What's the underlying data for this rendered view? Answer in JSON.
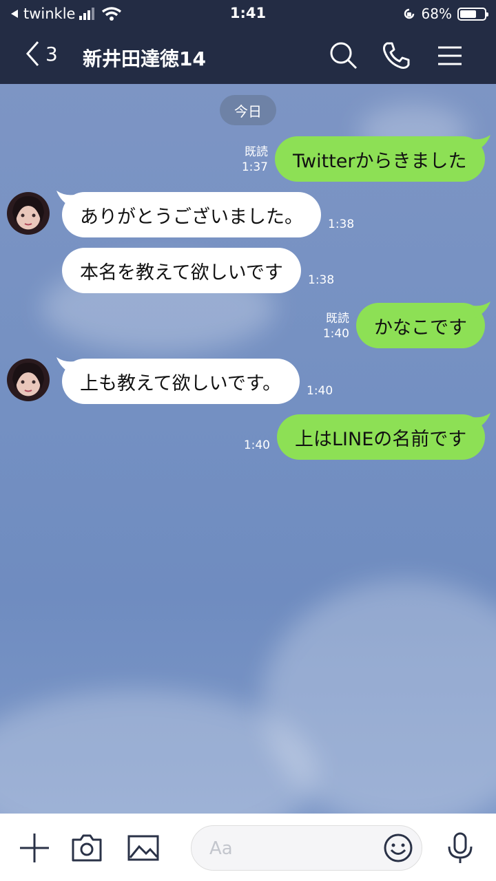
{
  "status_bar": {
    "carrier": "twinkle",
    "time": "1:41",
    "battery_pct": "68%",
    "battery_level": 0.68
  },
  "header": {
    "back_count": "3",
    "title": "新井田達徳14"
  },
  "date_divider": "今日",
  "messages": [
    {
      "dir": "out",
      "text": "Twitterからきました",
      "time": "1:37",
      "read": "既読"
    },
    {
      "dir": "in",
      "text": "ありがとうございました。",
      "time": "1:38",
      "avatar": true
    },
    {
      "dir": "in",
      "text": "本名を教えて欲しいです",
      "time": "1:38",
      "avatar": false
    },
    {
      "dir": "out",
      "text": "かなこです",
      "time": "1:40",
      "read": "既読"
    },
    {
      "dir": "in",
      "text": "上も教えて欲しいです。",
      "time": "1:40",
      "avatar": true
    },
    {
      "dir": "out",
      "text": "上はLINEの名前です",
      "time": "1:40",
      "read": ""
    }
  ],
  "input": {
    "placeholder": "Aa"
  },
  "icons": [
    "back-icon",
    "search-icon",
    "phone-icon",
    "menu-icon",
    "plus-icon",
    "camera-icon",
    "image-icon",
    "emoji-icon",
    "mic-icon"
  ],
  "colors": {
    "header_bg": "#232c44",
    "out_bubble": "#8de055",
    "in_bubble": "#ffffff",
    "chat_bg": "#7490c2"
  }
}
